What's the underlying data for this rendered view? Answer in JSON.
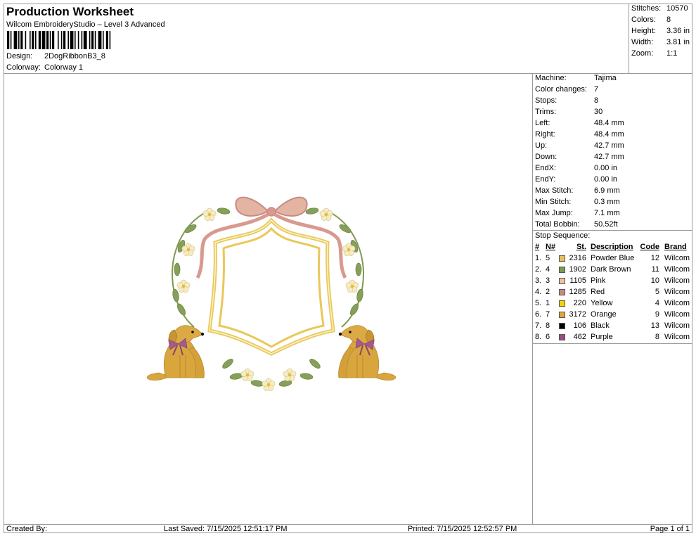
{
  "header": {
    "title": "Production Worksheet",
    "subtitle": "Wilcom EmbroideryStudio – Level 3 Advanced",
    "design_label": "Design:",
    "design_value": "2DogRibbonB3_8",
    "colorway_label": "Colorway:",
    "colorway_value": "Colorway 1"
  },
  "summary": [
    {
      "label": "Stitches:",
      "value": "10570"
    },
    {
      "label": "Colors:",
      "value": "8"
    },
    {
      "label": "Height:",
      "value": "3.36 in"
    },
    {
      "label": "Width:",
      "value": "3.81 in"
    },
    {
      "label": "Zoom:",
      "value": "1:1"
    }
  ],
  "machine_info": [
    {
      "label": "Machine:",
      "value": "Tajima"
    },
    {
      "label": "Color changes:",
      "value": "7"
    },
    {
      "label": "Stops:",
      "value": "8"
    },
    {
      "label": "Trims:",
      "value": "30"
    },
    {
      "label": "Left:",
      "value": "48.4 mm"
    },
    {
      "label": "Right:",
      "value": "48.4 mm"
    },
    {
      "label": "Up:",
      "value": "42.7 mm"
    },
    {
      "label": "Down:",
      "value": "42.7 mm"
    },
    {
      "label": "EndX:",
      "value": "0.00 in"
    },
    {
      "label": "EndY:",
      "value": "0.00 in"
    },
    {
      "label": "Max Stitch:",
      "value": "6.9 mm"
    },
    {
      "label": "Min Stitch:",
      "value": "0.3 mm"
    },
    {
      "label": "Max Jump:",
      "value": "7.1 mm"
    },
    {
      "label": "Total Bobbin:",
      "value": "50.52ft"
    }
  ],
  "stop_sequence": {
    "title": "Stop Sequence:",
    "headers": {
      "num": "#",
      "n": "N#",
      "st": "St.",
      "description": "Description",
      "code": "Code",
      "brand": "Brand"
    },
    "rows": [
      {
        "num": "1.",
        "n": "5",
        "color": "#e8c25a",
        "st": "2316",
        "description": "Powder Blue",
        "code": "12",
        "brand": "Wilcom"
      },
      {
        "num": "2.",
        "n": "4",
        "color": "#7f9a4e",
        "st": "1902",
        "description": "Dark Brown",
        "code": "11",
        "brand": "Wilcom"
      },
      {
        "num": "3.",
        "n": "3",
        "color": "#f2c2a0",
        "st": "1105",
        "description": "Pink",
        "code": "10",
        "brand": "Wilcom"
      },
      {
        "num": "4.",
        "n": "2",
        "color": "#c98a86",
        "st": "1285",
        "description": "Red",
        "code": "5",
        "brand": "Wilcom"
      },
      {
        "num": "5.",
        "n": "1",
        "color": "#f4d400",
        "st": "220",
        "description": "Yellow",
        "code": "4",
        "brand": "Wilcom"
      },
      {
        "num": "6.",
        "n": "7",
        "color": "#e0a43a",
        "st": "3172",
        "description": "Orange",
        "code": "9",
        "brand": "Wilcom"
      },
      {
        "num": "7.",
        "n": "8",
        "color": "#000000",
        "st": "106",
        "description": "Black",
        "code": "13",
        "brand": "Wilcom"
      },
      {
        "num": "8.",
        "n": "6",
        "color": "#9a4a86",
        "st": "462",
        "description": "Purple",
        "code": "8",
        "brand": "Wilcom"
      }
    ]
  },
  "footer": {
    "created_by": "Created By:",
    "last_saved": "Last Saved: 7/15/2025 12:51:17 PM",
    "printed": "Printed: 7/15/2025 12:52:57 PM",
    "page": "Page 1 of 1"
  }
}
